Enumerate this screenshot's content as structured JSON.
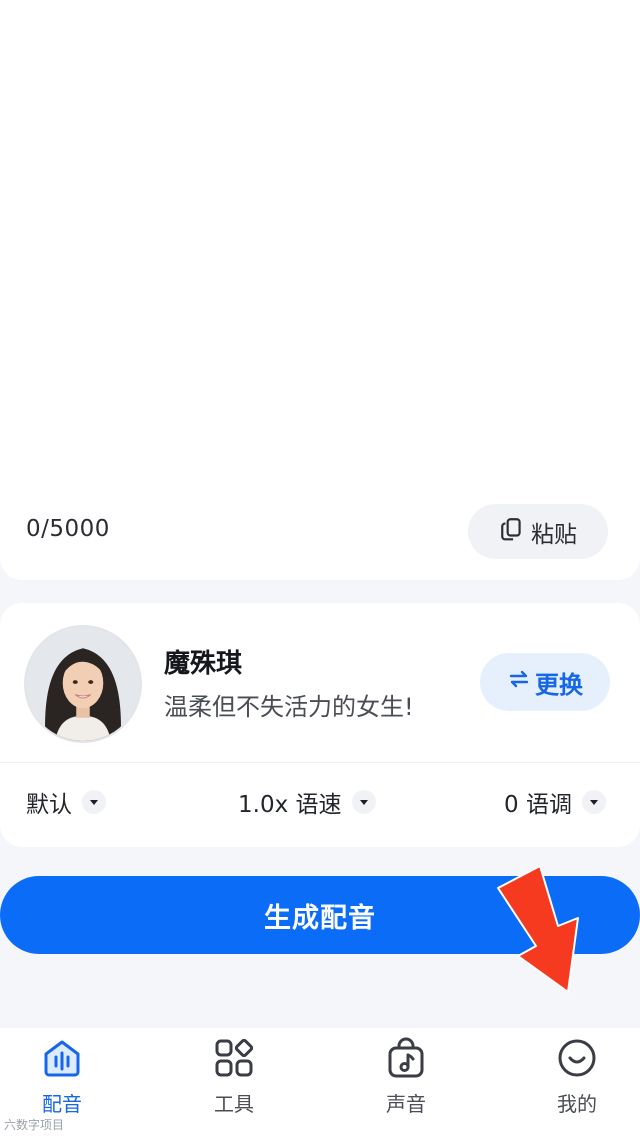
{
  "editor": {
    "placeholder": "",
    "counter": "0/5000",
    "paste_label": "粘贴",
    "paste_icon": "clipboard-icon"
  },
  "voice": {
    "name": "魔殊琪",
    "description": "温柔但不失活力的女生!",
    "change_label": "更换",
    "change_icon": "swap-icon"
  },
  "settings": {
    "style": "默认",
    "speed": "1.0x 语速",
    "pitch": "0 语调"
  },
  "generate_label": "生成配音",
  "tabs": [
    {
      "label": "配音",
      "icon": "voice-home-icon",
      "active": true
    },
    {
      "label": "工具",
      "icon": "grid-tools-icon",
      "active": false
    },
    {
      "label": "声音",
      "icon": "music-bag-icon",
      "active": false
    },
    {
      "label": "我的",
      "icon": "smile-icon",
      "active": false
    }
  ],
  "colors": {
    "accent": "#0a6cf7",
    "accent_light": "#e6f0fd",
    "annotation_arrow": "#f53a1f"
  },
  "watermark": "六数字项目"
}
